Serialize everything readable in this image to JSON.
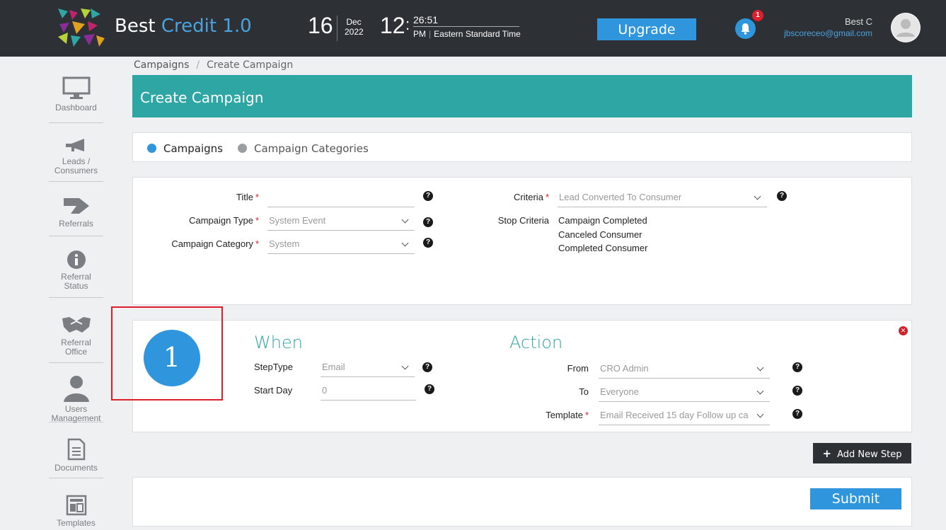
{
  "topbar": {
    "brand_prefix": "Best",
    "brand_suffix": "Credit 1.0",
    "date_day": "16",
    "date_month": "Dec",
    "date_year": "2022",
    "time_hour": "12",
    "time_minsec": "26:51",
    "time_ampm": "PM",
    "time_zone": "Eastern Standard Time",
    "upgrade_label": "Upgrade",
    "notification_count": "1",
    "user_name": "Best C",
    "user_email": "jbscoreceo@gmail.com"
  },
  "sidebar": {
    "items": [
      {
        "label": "Dashboard",
        "icon": "monitor-icon"
      },
      {
        "label": "Leads / Consumers",
        "icon": "megaphone-icon"
      },
      {
        "label": "Referrals",
        "icon": "arrow-right-icon"
      },
      {
        "label": "Referral Status",
        "icon": "info-icon"
      },
      {
        "label": "Referral Office",
        "icon": "handshake-icon"
      },
      {
        "label": "Users Management",
        "icon": "user-icon"
      },
      {
        "label": "Documents",
        "icon": "document-icon"
      },
      {
        "label": "Templates",
        "icon": "template-icon"
      }
    ]
  },
  "breadcrumb": {
    "root": "Campaigns",
    "separator": "/",
    "current": "Create Campaign"
  },
  "page_title": "Create Campaign",
  "tabs": [
    {
      "label": "Campaigns",
      "active": true,
      "color": "#2f96dd"
    },
    {
      "label": "Campaign Categories",
      "active": false,
      "color": "#9a9da2"
    }
  ],
  "form": {
    "title_label": "Title",
    "title_value": "",
    "type_label": "Campaign Type",
    "type_value": "System Event",
    "category_label": "Campaign Category",
    "category_value": "System",
    "criteria_label": "Criteria",
    "criteria_value": "Lead Converted To Consumer",
    "stop_label": "Stop Criteria",
    "stop_items": [
      "Campaign Completed",
      "Canceled Consumer",
      "Completed Consumer"
    ],
    "required_mark": "*",
    "help_glyph": "?"
  },
  "step": {
    "number": "1",
    "when_title": "When",
    "action_title": "Action",
    "steptype_label": "StepType",
    "steptype_value": "Email",
    "startday_label": "Start Day",
    "startday_value": "0",
    "from_label": "From",
    "from_value": "CRO Admin",
    "to_label": "To",
    "to_value": "Everyone",
    "template_label": "Template",
    "template_value": "Email Received 15 day Follow up ca",
    "close_glyph": "✕"
  },
  "actions": {
    "add_step_plus": "+",
    "add_step_label": "Add New Step",
    "submit_label": "Submit"
  },
  "colors": {
    "topbar": "#2d3035",
    "accent_blue": "#2f96dd",
    "teal": "#2ea6a3",
    "required_red": "#e01f2e"
  }
}
